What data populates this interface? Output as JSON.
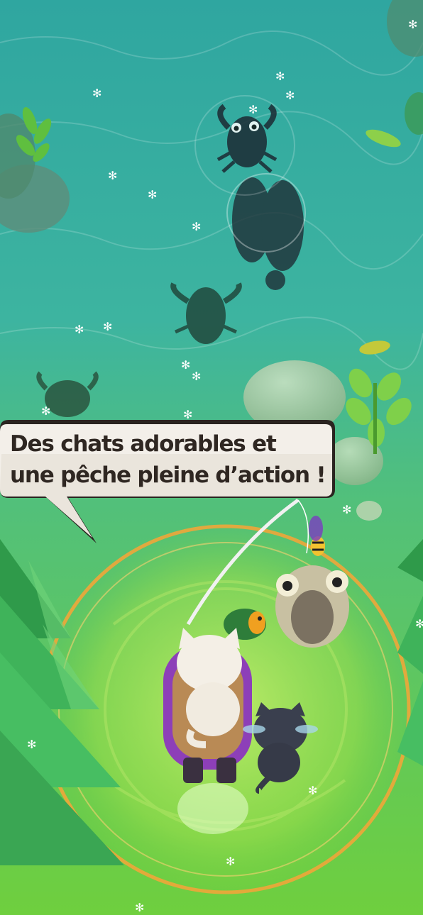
{
  "promo": {
    "line1": "Des chats adorables et",
    "line2": "une pêche pleine d’action !"
  },
  "scene": {
    "creatures": [
      "scorpion-shadow",
      "leech-shadow",
      "scorpion-shadow",
      "scorpion-shadow"
    ],
    "player": [
      "white-cat",
      "black-cat",
      "purple-boat"
    ],
    "catch": [
      "green-fish",
      "puffer-fish"
    ],
    "colors": {
      "water_top": "#2fa6a0",
      "water_bottom": "#6fcf3e",
      "ring": "#f0a63a",
      "bubble_fill": "#f3efe9",
      "bubble_border": "#2a2420",
      "boat": "#8d3fb8"
    }
  }
}
